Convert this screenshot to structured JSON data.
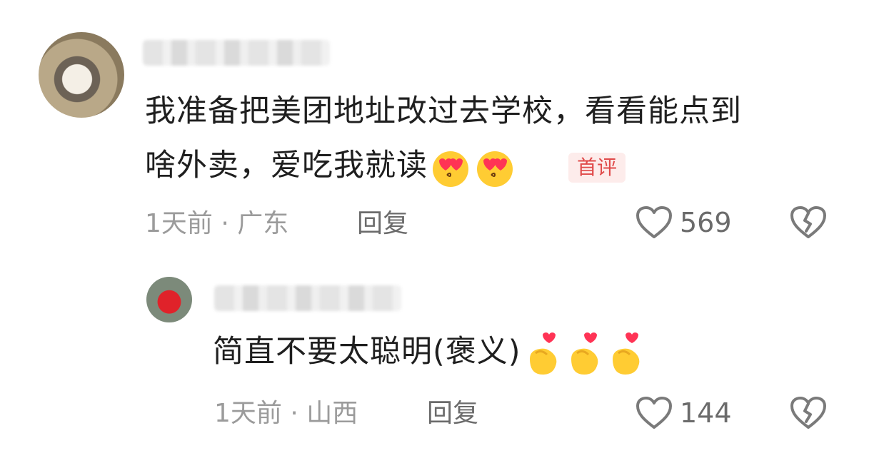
{
  "comments": [
    {
      "text_line1": "我准备把美团地址改过去学校，看看能点到",
      "text_line2": "啥外卖，爱吃我就读",
      "emojis": [
        "heart-eyes-emoji",
        "heart-eyes-emoji"
      ],
      "badge": "首评",
      "time": "1天前",
      "separator": "·",
      "location": "广东",
      "reply_label": "回复",
      "likes": "569"
    },
    {
      "text": "简直不要太聪明(褒义)",
      "emojis": [
        "finger-heart-emoji",
        "finger-heart-emoji",
        "finger-heart-emoji"
      ],
      "time": "1天前",
      "separator": "·",
      "location": "山西",
      "reply_label": "回复",
      "likes": "144"
    }
  ],
  "colors": {
    "text": "#1f1f1f",
    "meta": "#9b9b9b",
    "badge_text": "#e04a4a",
    "badge_bg": "#fdeceb"
  }
}
